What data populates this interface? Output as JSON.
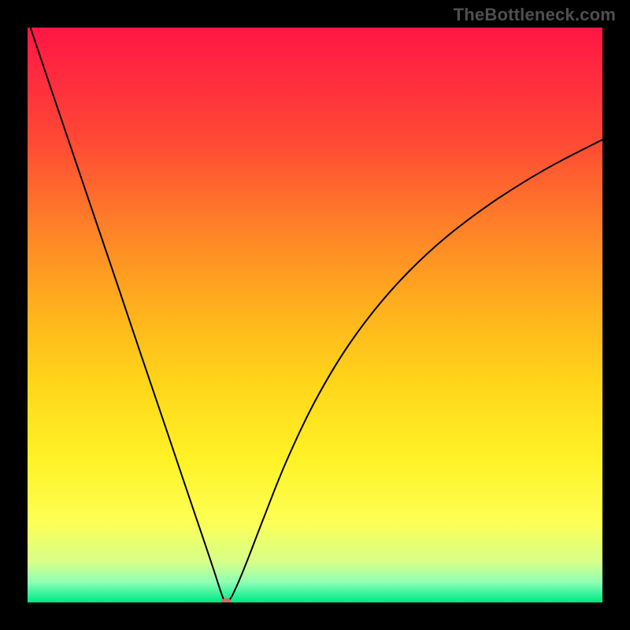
{
  "watermark": "TheBottleneck.com",
  "chart_data": {
    "type": "line",
    "title": "",
    "xlabel": "",
    "ylabel": "",
    "xlim": [
      0,
      100
    ],
    "ylim": [
      0,
      100
    ],
    "grid": false,
    "legend": false,
    "background_gradient": {
      "stops": [
        {
          "offset": 0.0,
          "color": "#ff1744"
        },
        {
          "offset": 0.08,
          "color": "#ff2a3f"
        },
        {
          "offset": 0.2,
          "color": "#ff4a34"
        },
        {
          "offset": 0.35,
          "color": "#ff8228"
        },
        {
          "offset": 0.5,
          "color": "#ffb41c"
        },
        {
          "offset": 0.62,
          "color": "#ffd61a"
        },
        {
          "offset": 0.75,
          "color": "#fff226"
        },
        {
          "offset": 0.86,
          "color": "#fdff55"
        },
        {
          "offset": 0.93,
          "color": "#d6ff8a"
        },
        {
          "offset": 0.965,
          "color": "#8fffb3"
        },
        {
          "offset": 0.985,
          "color": "#36f39c"
        },
        {
          "offset": 1.0,
          "color": "#00e77f"
        }
      ]
    },
    "series": [
      {
        "name": "bottleneck-curve",
        "color": "#000000",
        "stroke_width": 2,
        "x": [
          0.5,
          4,
          8,
          12,
          16,
          20,
          24,
          27,
          29,
          31,
          32.5,
          33.6,
          34.2,
          34.55,
          34.9,
          35.6,
          36.8,
          38.5,
          41,
          45,
          50,
          56,
          63,
          71,
          80,
          90,
          100
        ],
        "y": [
          100,
          89.6,
          77.8,
          66.0,
          54.2,
          42.3,
          30.5,
          21.6,
          15.7,
          9.8,
          5.3,
          1.9,
          0.3,
          0.0,
          0.2,
          1.2,
          3.8,
          8.0,
          14.5,
          24.5,
          35.0,
          45.0,
          54.0,
          62.0,
          69.0,
          75.3,
          80.5
        ]
      }
    ],
    "marker": {
      "name": "optimal-point",
      "x": 34.55,
      "y": 0,
      "rx": 6.2,
      "ry": 4.6,
      "color": "#cf6a5f"
    }
  }
}
